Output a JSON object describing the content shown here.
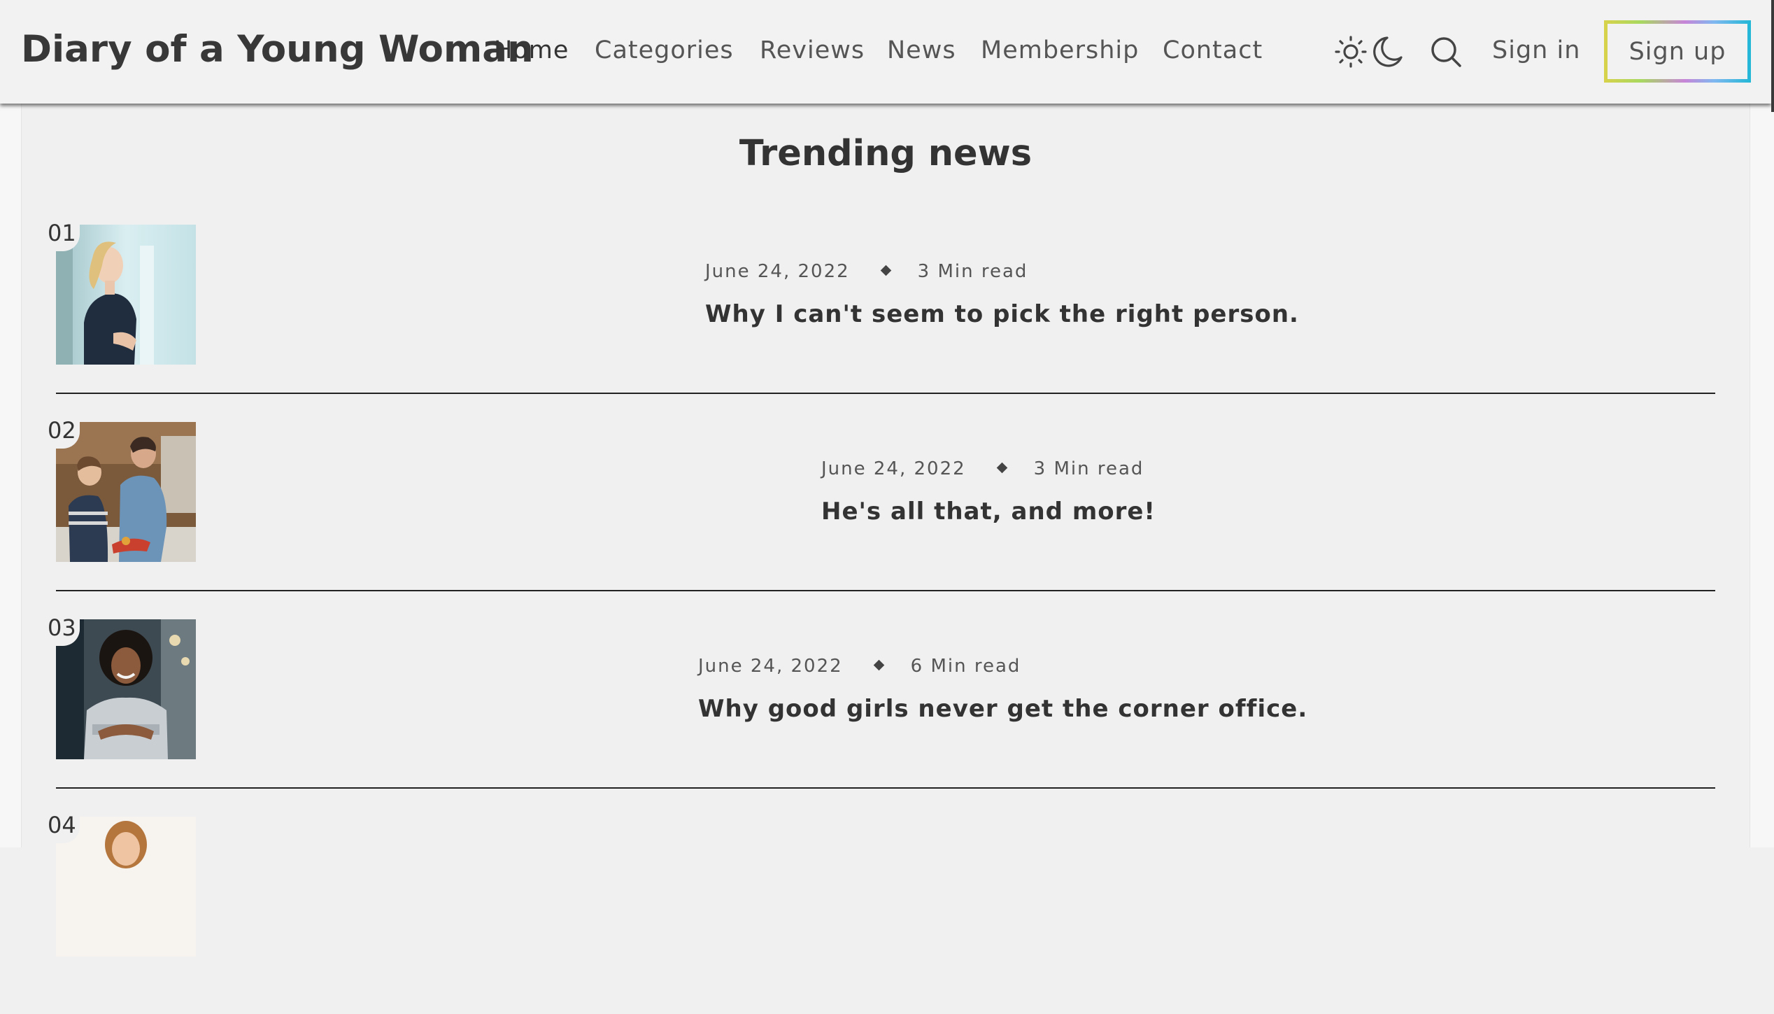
{
  "site": {
    "logo": "Diary of a Young Woman"
  },
  "nav": {
    "items": [
      "Home",
      "Categories",
      "Reviews",
      "News",
      "Membership",
      "Contact"
    ],
    "active": "Home",
    "theme_icons": [
      "sun-icon",
      "moon-icon"
    ],
    "search_icon": "search-icon",
    "signin_label": "Sign in",
    "signup_label": "Sign up"
  },
  "colors": {
    "background": "#f0f0f0",
    "text": "#333333",
    "signup_border_gradient": [
      "#d8d24a",
      "#a8d860",
      "#c785d8",
      "#7fb8f0",
      "#22b7d6"
    ]
  },
  "trending": {
    "title": "Trending news",
    "items": [
      {
        "number": "01",
        "date": "June 24, 2022",
        "read_time": "3 Min read",
        "title": "Why I can't seem to pick the right person."
      },
      {
        "number": "02",
        "date": "June 24, 2022",
        "read_time": "3 Min read",
        "title": "He's all that, and more!"
      },
      {
        "number": "03",
        "date": "June 24, 2022",
        "read_time": "6 Min read",
        "title": "Why good girls never get the corner office."
      },
      {
        "number": "04"
      }
    ]
  }
}
